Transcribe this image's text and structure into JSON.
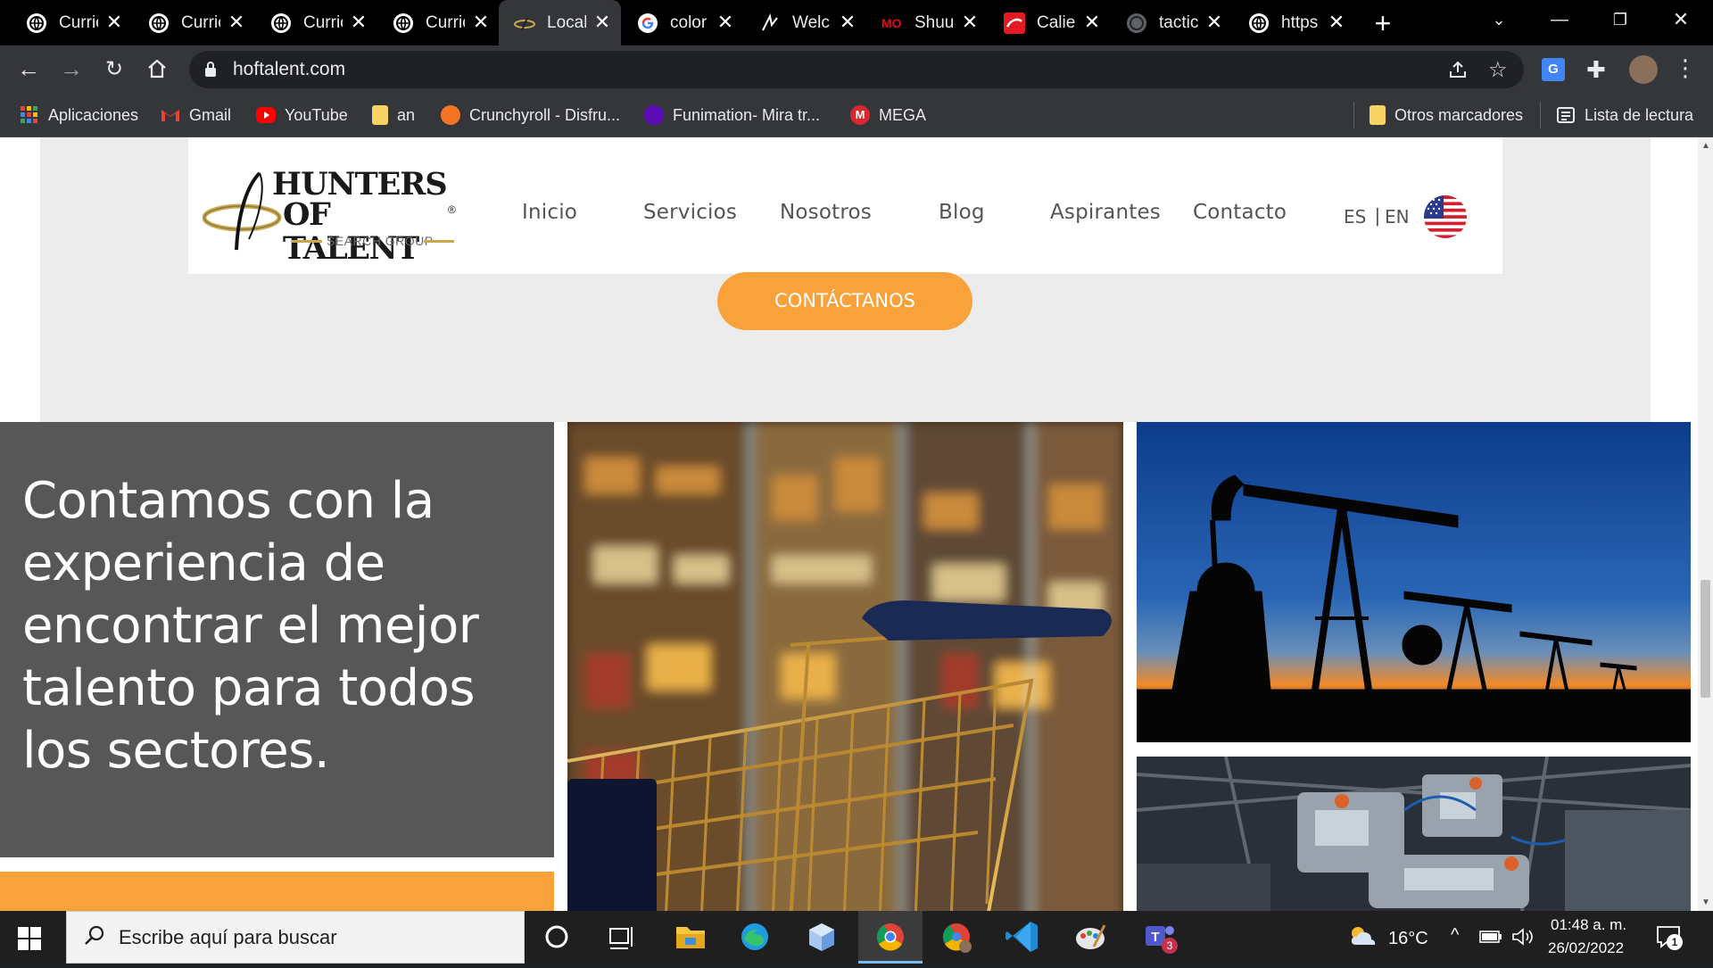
{
  "browser": {
    "tabs": [
      {
        "label": "Curric",
        "icon": "globe-icon",
        "active": false
      },
      {
        "label": "Curric",
        "icon": "globe-icon",
        "active": false
      },
      {
        "label": "Curric",
        "icon": "globe-icon",
        "active": false
      },
      {
        "label": "Curric",
        "icon": "globe-icon",
        "active": false
      },
      {
        "label": "Local",
        "icon": "hunters-logo-icon",
        "active": true
      },
      {
        "label": "color",
        "icon": "google-icon",
        "active": false
      },
      {
        "label": "Welc",
        "icon": "arrow-logo-icon",
        "active": false
      },
      {
        "label": "Shuu",
        "icon": "mo-logo-icon",
        "active": false
      },
      {
        "label": "Calie",
        "icon": "caliente-icon",
        "active": false
      },
      {
        "label": "tactic",
        "icon": "globe-icon",
        "active": false
      },
      {
        "label": "https",
        "icon": "globe-icon",
        "active": false
      }
    ],
    "url": "hoftalent.com",
    "bookmarks": [
      {
        "label": "Aplicaciones",
        "icon": "apps-grid-icon"
      },
      {
        "label": "Gmail",
        "icon": "gmail-icon"
      },
      {
        "label": "YouTube",
        "icon": "youtube-icon"
      },
      {
        "label": "an",
        "icon": "folder-icon"
      },
      {
        "label": "Crunchyroll - Disfru...",
        "icon": "crunchyroll-icon"
      },
      {
        "label": "Funimation- Mira tr...",
        "icon": "funimation-icon"
      },
      {
        "label": "MEGA",
        "icon": "mega-icon"
      }
    ],
    "other_bookmarks": "Otros marcadores",
    "reading_list": "Lista de lectura"
  },
  "site": {
    "logo": {
      "line1": "HUNTERS",
      "line2": "OF TALENT",
      "line3": "SEARCH GROUP",
      "reg": "®"
    },
    "nav": [
      "Inicio",
      "Servicios",
      "Nosotros",
      "Blog",
      "Aspirantes",
      "Contacto"
    ],
    "lang_es": "ES",
    "lang_sep": "|",
    "lang_en": "EN",
    "cta": "CONTÁCTANOS",
    "headline": "Contamos con la experiencia de encontrar el mejor talento para todos los sectores.",
    "accent": "#f9a23b"
  },
  "taskbar": {
    "search_placeholder": "Escribe aquí para buscar",
    "temperature": "16°C",
    "time": "01:48 a. m.",
    "date": "26/02/2022",
    "notifications": "1",
    "teams_badge": "3"
  }
}
